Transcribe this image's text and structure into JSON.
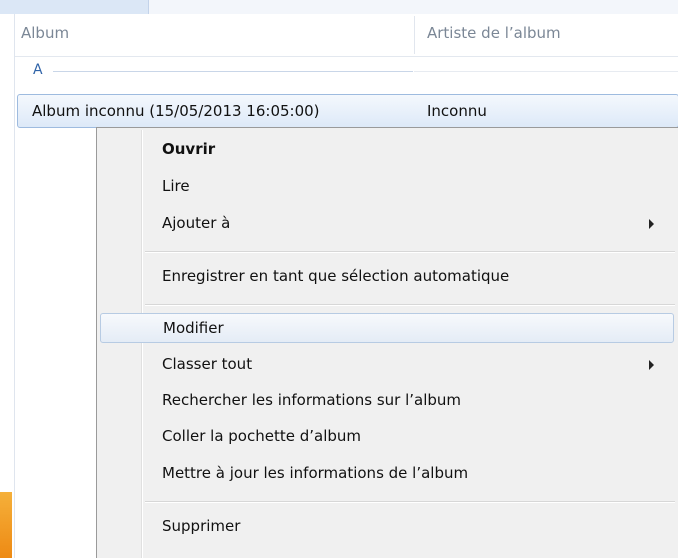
{
  "columns": {
    "album": "Album",
    "artist": "Artiste de l’album"
  },
  "group": {
    "letter": "A"
  },
  "selected_row": {
    "album": "Album inconnu (15/05/2013 16:05:00)",
    "artist": "Inconnu"
  },
  "context_menu": {
    "items": [
      {
        "label": "Ouvrir",
        "bold": true
      },
      {
        "label": "Lire"
      },
      {
        "label": "Ajouter à",
        "submenu": true
      },
      {
        "label": "Enregistrer en tant que sélection automatique"
      },
      {
        "label": "Modifier",
        "highlighted": true
      },
      {
        "label": "Classer tout",
        "submenu": true
      },
      {
        "label": "Rechercher les informations sur l’album"
      },
      {
        "label": "Coller la pochette d’album"
      },
      {
        "label": "Mettre à jour les informations de l’album"
      },
      {
        "label": "Supprimer"
      }
    ]
  },
  "colors": {
    "selection": "#dde9f8",
    "menu_background": "#f0f0f0",
    "group_accent": "#2f63a8"
  }
}
